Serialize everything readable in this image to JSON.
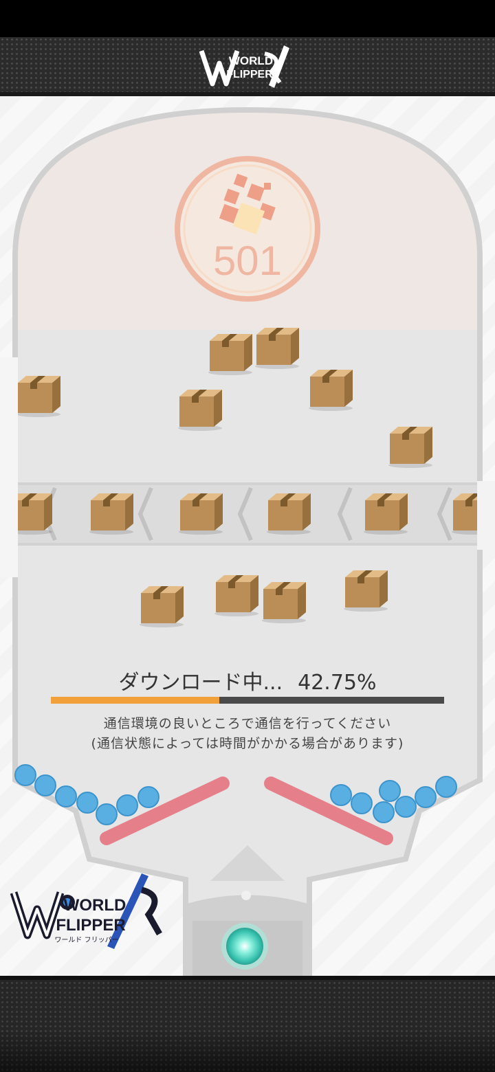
{
  "header": {
    "logo_text_line1": "WORLD",
    "logo_text_line2": "FLIPPER"
  },
  "counter": {
    "value": "501"
  },
  "download": {
    "label": "ダウンロード中...",
    "percent_text": "42.75%",
    "progress_percent": 42.75
  },
  "notice": {
    "line1": "通信環境の良いところで通信を行ってください",
    "line2": "(通信状態によっては時間がかかる場合があります)"
  },
  "corner_logo": {
    "line1": "WORLD",
    "line2": "FLIPPER",
    "katakana": "ワールド フリッパー"
  },
  "colors": {
    "progress_fill": "#f2a13a",
    "progress_track": "#4a4a4a",
    "flipper": "#e5808a",
    "ball": "#5aafe2",
    "counter_ring": "#efb7a2"
  },
  "icons": {
    "counter": "puzzle-blocks-icon",
    "box": "cardboard-box-icon",
    "ball": "ball-icon",
    "launcher": "glowing-orb-icon"
  }
}
